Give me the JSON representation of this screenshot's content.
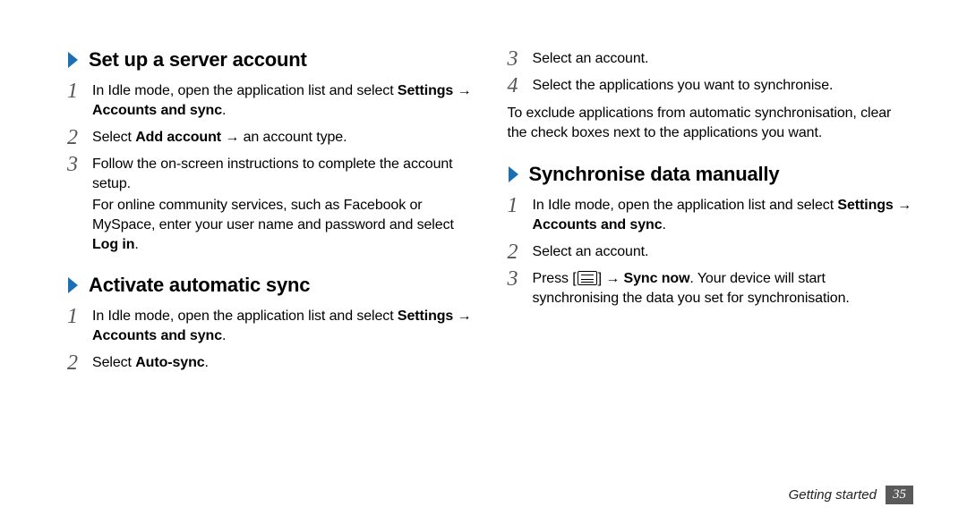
{
  "left": {
    "section1": {
      "title": "Set up a server account",
      "steps": [
        {
          "num": "1",
          "text_a": "In Idle mode, open the application list and select ",
          "bold_a": "Settings",
          "arrow_a": " → ",
          "bold_b": "Accounts and sync",
          "text_b": "."
        },
        {
          "num": "2",
          "text_a": "Select ",
          "bold_a": "Add account",
          "arrow_a": " → ",
          "text_b": "an account type."
        },
        {
          "num": "3",
          "text_a": "Follow the on-screen instructions to complete the account setup.",
          "para2_a": "For online community services, such as Facebook or MySpace, enter your user name and password and select ",
          "para2_bold": "Log in",
          "para2_b": "."
        }
      ]
    },
    "section2": {
      "title": "Activate automatic sync",
      "steps": [
        {
          "num": "1",
          "text_a": "In Idle mode, open the application list and select ",
          "bold_a": "Settings",
          "arrow_a": " → ",
          "bold_b": "Accounts and sync",
          "text_b": "."
        },
        {
          "num": "2",
          "text_a": "Select ",
          "bold_a": "Auto-sync",
          "text_b": "."
        }
      ]
    }
  },
  "right": {
    "topsteps": [
      {
        "num": "3",
        "text_a": "Select an account."
      },
      {
        "num": "4",
        "text_a": "Select the applications you want to synchronise."
      }
    ],
    "note": "To exclude applications from automatic synchronisation, clear the check boxes next to the applications you want.",
    "section3": {
      "title": "Synchronise data manually",
      "steps": [
        {
          "num": "1",
          "text_a": "In Idle mode, open the application list and select ",
          "bold_a": "Settings",
          "arrow_a": " → ",
          "bold_b": "Accounts and sync",
          "text_b": "."
        },
        {
          "num": "2",
          "text_a": "Select an account."
        },
        {
          "num": "3",
          "text_a": "Press [",
          "icon": "menu",
          "text_b": "] → ",
          "bold_a": "Sync now",
          "text_c": ". Your device will start synchronising the data you set for synchronisation."
        }
      ]
    }
  },
  "footer": {
    "section": "Getting started",
    "page": "35"
  }
}
